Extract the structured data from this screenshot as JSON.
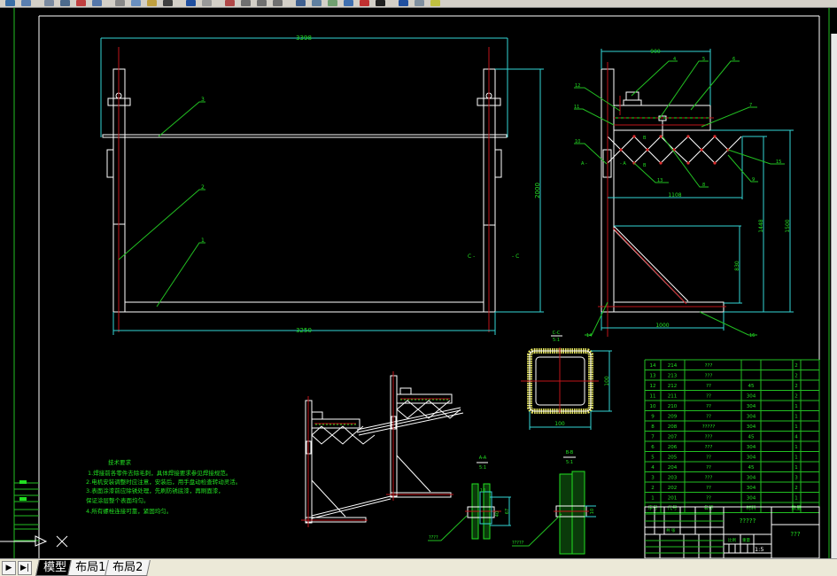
{
  "toolbar": {
    "icons": [
      "new-icon",
      "open-icon",
      "save-icon",
      "print-icon",
      "preview-icon",
      "publish-icon",
      "cut-icon",
      "copy-icon",
      "paste-icon",
      "match-icon",
      "undo-icon",
      "redo-icon",
      "pan-icon",
      "zoom-realtime-icon",
      "zoom-window-icon",
      "zoom-previous-icon",
      "properties-icon",
      "design-center-icon",
      "tool-palette-icon",
      "sheet-set-icon",
      "markup-icon",
      "calculator-icon",
      "help-icon",
      "layer-icon",
      "layer-state-icon"
    ]
  },
  "colors": {
    "background": "#000000",
    "object": "#ffffff",
    "centerline": "#c0141a",
    "dimension": "#33d6d6",
    "annotation": "#22e022",
    "frame": "#22c022"
  },
  "front_view": {
    "dim_top": "3398",
    "dim_bottom": "3250",
    "dim_right": "2000",
    "labels": [
      "3",
      "2",
      "1"
    ],
    "section_mark_left": "C -",
    "section_mark_right": "- C"
  },
  "side_view": {
    "dim_top": "900",
    "dim_scissor": "1108",
    "dim_inner": "1448",
    "dim_outer": "1500",
    "dim_brace": "830",
    "dim_base": "1000",
    "labels": {
      "l4": "4",
      "l5": "5",
      "l6": "6",
      "l12": "12",
      "l11": "11",
      "l7": "7",
      "l10": "10",
      "l13": "13",
      "l8": "8",
      "l9": "9",
      "l15": "15",
      "l14": "14",
      "l16": "16"
    },
    "section_a_left": "A -",
    "section_a_right": "- A",
    "section_b_top": "B",
    "section_b_bottom": "B"
  },
  "section_c": {
    "title": "C-C",
    "scale": "5:1",
    "dim_height": "100",
    "dim_width": "100"
  },
  "detail_a": {
    "title": "A-A",
    "scale": "5:1",
    "dim1": "10",
    "dim2": "40",
    "dim3": "67",
    "leader": "????"
  },
  "detail_b": {
    "title": "B-B",
    "scale": "5:1",
    "dim1": "10",
    "leader": "?????"
  },
  "tech_notes": {
    "title": "技术要求",
    "lines": [
      "1.焊接前各零件去除毛刺，具体焊接要求参见焊接规范。",
      "2.电机安装调整时应注意，安装后，用手盘动检查转动灵活。",
      "3.表面涂漆前应除锈处理，先刷防锈底漆，再刷面漆，",
      "保证涂层整个表面均匀。",
      "4.所有螺栓连接可靠，紧固均匀。"
    ]
  },
  "bom": {
    "rows": [
      {
        "no": "14",
        "code": "214",
        "name": "???",
        "material": "",
        "qty": "2"
      },
      {
        "no": "13",
        "code": "213",
        "name": "???",
        "material": "",
        "qty": "2"
      },
      {
        "no": "12",
        "code": "212",
        "name": "??",
        "material": "45",
        "qty": "2"
      },
      {
        "no": "11",
        "code": "211",
        "name": "??",
        "material": "304",
        "qty": "2"
      },
      {
        "no": "10",
        "code": "210",
        "name": "??",
        "material": "304",
        "qty": "1"
      },
      {
        "no": "9",
        "code": "209",
        "name": "??",
        "material": "304",
        "qty": "1"
      },
      {
        "no": "8",
        "code": "208",
        "name": "?????",
        "material": "304",
        "qty": "1"
      },
      {
        "no": "7",
        "code": "207",
        "name": "???",
        "material": "45",
        "qty": "4"
      },
      {
        "no": "6",
        "code": "206",
        "name": "???",
        "material": "304",
        "qty": "1"
      },
      {
        "no": "5",
        "code": "205",
        "name": "??",
        "material": "304",
        "qty": "1"
      },
      {
        "no": "4",
        "code": "204",
        "name": "??",
        "material": "45",
        "qty": "1"
      },
      {
        "no": "3",
        "code": "203",
        "name": "???",
        "material": "304",
        "qty": "3"
      },
      {
        "no": "2",
        "code": "202",
        "name": "??",
        "material": "304",
        "qty": "2"
      },
      {
        "no": "1",
        "code": "201",
        "name": "??",
        "material": "304",
        "qty": "1"
      }
    ],
    "header": {
      "no": "序号",
      "code": "代号",
      "name": "名称",
      "material": "材料",
      "weight": "重量",
      "qty": "数量"
    }
  },
  "title_block": {
    "drawing_name": "?????",
    "company": "???",
    "scale": "1:5",
    "scale_label": "比例",
    "weight_label": "重量",
    "sheet_label": "共 张"
  },
  "tabs": {
    "items": [
      "模型",
      "布局1",
      "布局2"
    ],
    "active": 0
  },
  "nav": {
    "next": "▶",
    "last": "▶|"
  }
}
